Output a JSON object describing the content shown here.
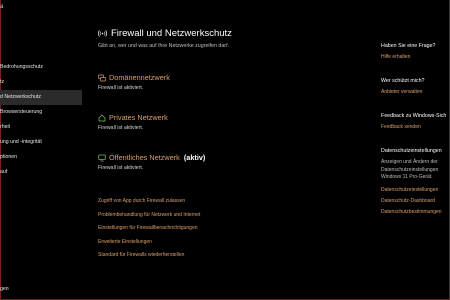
{
  "window": {
    "corner_glyph": "a"
  },
  "sidebar": {
    "items": [
      {
        "label": "Bedrohungsschutz"
      },
      {
        "label": "tz"
      },
      {
        "label": "d Netzwerkschutz",
        "active": true
      },
      {
        "label": "Browsersteuerung"
      },
      {
        "label": "rheit"
      },
      {
        "label": "ung und -integrität"
      },
      {
        "label": "ptionen"
      },
      {
        "label": "auf"
      }
    ],
    "bottom_label": "gen"
  },
  "main": {
    "title": "Firewall und Netzwerkschutz",
    "subtitle": "Gibt an, wer und was auf Ihre Netzwerke zugreifen darf.",
    "networks": [
      {
        "name": "Domänennetzwerk",
        "status": "Firewall ist aktiviert.",
        "icon": "domain-network-icon",
        "badge": ""
      },
      {
        "name": "Privates Netzwerk",
        "status": "Firewall ist aktiviert.",
        "icon": "private-network-icon",
        "badge": ""
      },
      {
        "name": "Öffentliches Netzwerk",
        "status": "Firewall ist aktiviert.",
        "icon": "public-network-icon",
        "badge": "(aktiv)"
      }
    ],
    "links": [
      "Zugriff von App durch Firewall zulassen",
      "Problembehandlung für Netzwerk und Internet",
      "Einstellungen für Firewallbenachrichtigungen",
      "Erweiterte Einstellungen",
      "Standard für Firewalls wiederherstellen"
    ]
  },
  "right_panel": {
    "question": {
      "heading": "Haben Sie eine Frage?",
      "link": "Hilfe erhalten"
    },
    "protection": {
      "heading": "Wer schützt mich?",
      "link": "Anbieter verwalten"
    },
    "feedback": {
      "heading": "Feedback zu Windows-Sich",
      "link": "Feedback senden"
    },
    "privacy": {
      "heading": "Datenschutzeinstellungen",
      "lines": [
        "Anzeigen und Ändern der",
        "Datenschutzeinstellungen",
        "Windows 11 Pro-Gerät."
      ],
      "links": [
        "Datenschutzeinstellungen",
        "Datenschutz-Dashboard",
        "Datenschutzbestimmungen"
      ]
    }
  },
  "colors": {
    "accent": "#d9a06a",
    "background": "#000000",
    "active_nav": "#2b2b2b",
    "frame_edge": "#7a1f1f"
  }
}
